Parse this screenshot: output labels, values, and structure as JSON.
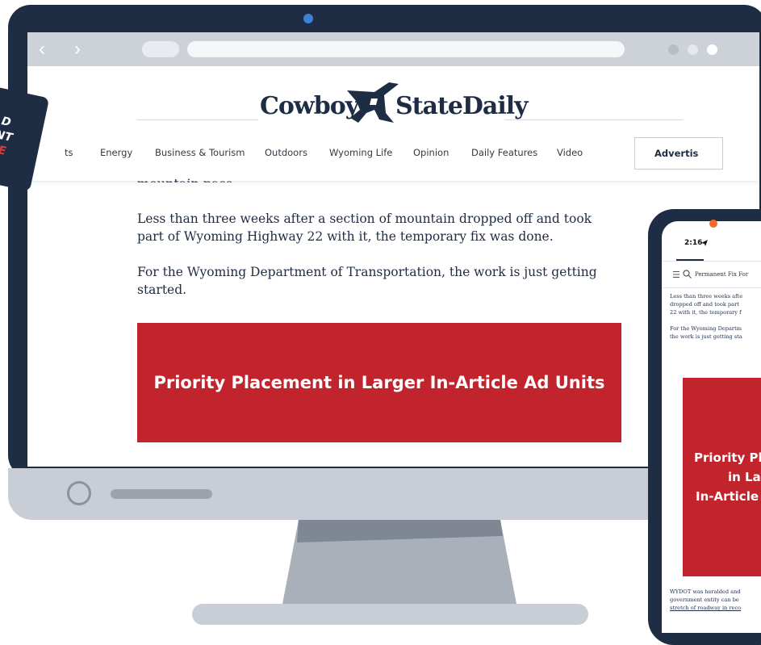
{
  "badge": {
    "lines": [
      "D",
      "NT",
      "UE"
    ],
    "colors": [
      "#ffffff",
      "#ffffff",
      "#e03a3a"
    ]
  },
  "browser": {
    "back_icon": "chevron-left-icon",
    "forward_icon": "chevron-right-icon",
    "back_glyph": "‹",
    "forward_glyph": "›"
  },
  "site": {
    "logo_left": "Cowboy",
    "logo_right": "StateDaily",
    "nav_items": [
      "ts",
      "Energy",
      "Business & Tourism",
      "Outdoors",
      "Wyoming Life",
      "Opinion",
      "Daily Features",
      "Video"
    ],
    "advertise_label": "Advertis"
  },
  "article": {
    "cutoff_line": "mountain pass.",
    "paragraphs": [
      "Less than three weeks after a section of mountain dropped off and took part of Wyoming Highway 22 with it, the temporary fix was done.",
      "For the Wyoming Department of Transportation, the work is just getting started."
    ],
    "ad_text": "Priority Placement in Larger In-Article Ad Units"
  },
  "phone": {
    "time": "2:16",
    "menu_icon": "menu-icon",
    "search_icon": "search-icon",
    "headline": "Permanent Fix For",
    "para1": [
      "Less than three weeks afte",
      "dropped off and took part",
      "22 with it, the temporary f"
    ],
    "para2": [
      "For the Wyoming Departm",
      "the work is just getting sta"
    ],
    "ad_lines": [
      "Priority Pl",
      "in La",
      "In-Article"
    ],
    "para3": [
      "WYDOT was heralded and",
      "government entity can be",
      "stretch of roadway in reco"
    ]
  },
  "colors": {
    "navy": "#1e2c44",
    "ad_red": "#c1242c",
    "accent_blue": "#3b82d4",
    "phone_accent": "#f26b2b"
  }
}
